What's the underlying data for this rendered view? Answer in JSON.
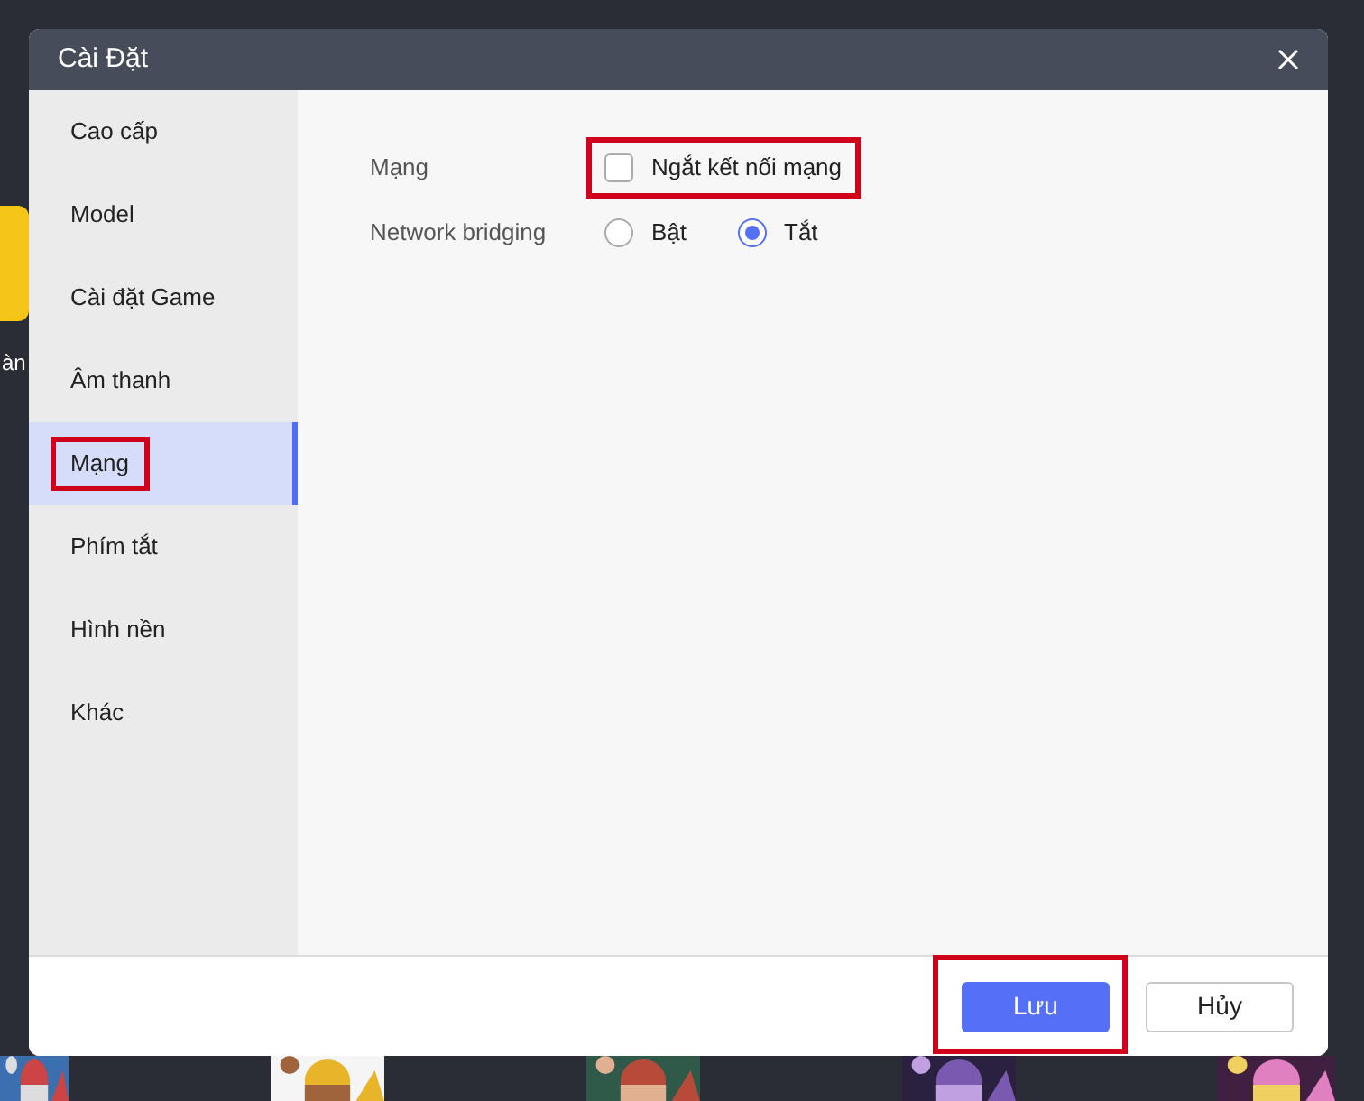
{
  "background": {
    "side_label": "àn"
  },
  "dialog": {
    "title": "Cài Đặt",
    "sidebar": {
      "items": [
        {
          "label": "Cao cấp",
          "selected": false,
          "highlighted": false
        },
        {
          "label": "Model",
          "selected": false,
          "highlighted": false
        },
        {
          "label": "Cài đặt Game",
          "selected": false,
          "highlighted": false
        },
        {
          "label": "Âm thanh",
          "selected": false,
          "highlighted": false
        },
        {
          "label": "Mạng",
          "selected": true,
          "highlighted": true
        },
        {
          "label": "Phím tắt",
          "selected": false,
          "highlighted": false
        },
        {
          "label": "Hình nền",
          "selected": false,
          "highlighted": false
        },
        {
          "label": "Khác",
          "selected": false,
          "highlighted": false
        }
      ]
    },
    "settings": [
      {
        "kind": "checkbox",
        "label": "Mạng",
        "option": {
          "label": "Ngắt kết nối mạng",
          "checked": false,
          "highlighted": true
        }
      },
      {
        "kind": "radio",
        "label": "Network bridging",
        "options": [
          {
            "label": "Bật",
            "selected": false
          },
          {
            "label": "Tắt",
            "selected": true
          }
        ]
      }
    ],
    "buttons": [
      {
        "label": "Lưu",
        "kind": "primary",
        "highlighted": true
      },
      {
        "label": "Hủy",
        "kind": "secondary",
        "highlighted": false
      }
    ]
  }
}
